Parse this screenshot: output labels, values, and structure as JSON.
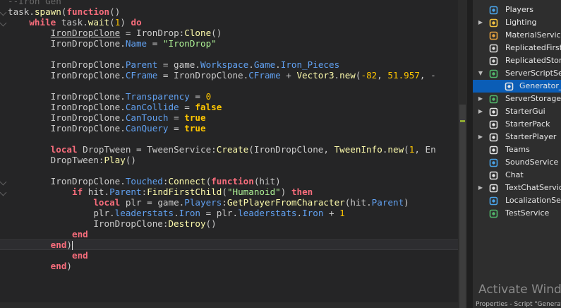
{
  "editor": {
    "lines": [
      [
        {
          "t": "--Iron Gen",
          "c": "faded"
        }
      ],
      [
        {
          "t": "task",
          "c": "plain"
        },
        {
          "t": ".",
          "c": "op"
        },
        {
          "t": "spawn",
          "c": "fn"
        },
        {
          "t": "(",
          "c": "op"
        },
        {
          "t": "function",
          "c": "kw"
        },
        {
          "t": "()",
          "c": "op"
        }
      ],
      [
        {
          "t": "    ",
          "c": "plain"
        },
        {
          "t": "while",
          "c": "kw"
        },
        {
          "t": " task",
          "c": "plain"
        },
        {
          "t": ".",
          "c": "op"
        },
        {
          "t": "wait",
          "c": "fn"
        },
        {
          "t": "(",
          "c": "op"
        },
        {
          "t": "1",
          "c": "num"
        },
        {
          "t": ") ",
          "c": "op"
        },
        {
          "t": "do",
          "c": "kw"
        }
      ],
      [
        {
          "t": "        ",
          "c": "plain"
        },
        {
          "t": "IronDropClone",
          "c": "plain ul"
        },
        {
          "t": " = IronDrop:",
          "c": "plain"
        },
        {
          "t": "Clone",
          "c": "fn"
        },
        {
          "t": "()",
          "c": "op"
        }
      ],
      [
        {
          "t": "        IronDropClone.",
          "c": "plain"
        },
        {
          "t": "Name",
          "c": "prop"
        },
        {
          "t": " = ",
          "c": "op"
        },
        {
          "t": "\"IronDrop\"",
          "c": "str"
        }
      ],
      [
        {
          "t": "",
          "c": "plain"
        }
      ],
      [
        {
          "t": "        IronDropClone.",
          "c": "plain"
        },
        {
          "t": "Parent",
          "c": "prop"
        },
        {
          "t": " = game.",
          "c": "plain"
        },
        {
          "t": "Workspace",
          "c": "prop"
        },
        {
          "t": ".",
          "c": "op"
        },
        {
          "t": "Game",
          "c": "prop"
        },
        {
          "t": ".",
          "c": "op"
        },
        {
          "t": "Iron_Pieces",
          "c": "prop"
        }
      ],
      [
        {
          "t": "        IronDropClone.",
          "c": "plain"
        },
        {
          "t": "CFrame",
          "c": "prop"
        },
        {
          "t": " = IronDropClone.",
          "c": "plain"
        },
        {
          "t": "CFrame",
          "c": "prop"
        },
        {
          "t": " + ",
          "c": "op"
        },
        {
          "t": "Vector3",
          "c": "fn"
        },
        {
          "t": ".",
          "c": "op"
        },
        {
          "t": "new",
          "c": "fn"
        },
        {
          "t": "(",
          "c": "op"
        },
        {
          "t": "-82",
          "c": "num"
        },
        {
          "t": ", ",
          "c": "op"
        },
        {
          "t": "51.957",
          "c": "num"
        },
        {
          "t": ", -",
          "c": "op"
        }
      ],
      [
        {
          "t": "",
          "c": "plain"
        }
      ],
      [
        {
          "t": "        IronDropClone.",
          "c": "plain"
        },
        {
          "t": "Transparency",
          "c": "prop"
        },
        {
          "t": " = ",
          "c": "op"
        },
        {
          "t": "0",
          "c": "num"
        }
      ],
      [
        {
          "t": "        IronDropClone.",
          "c": "plain"
        },
        {
          "t": "CanCollide",
          "c": "prop"
        },
        {
          "t": " = ",
          "c": "op"
        },
        {
          "t": "false",
          "c": "bool"
        }
      ],
      [
        {
          "t": "        IronDropClone.",
          "c": "plain"
        },
        {
          "t": "CanTouch",
          "c": "prop"
        },
        {
          "t": " = ",
          "c": "op"
        },
        {
          "t": "true",
          "c": "bool"
        }
      ],
      [
        {
          "t": "        IronDropClone.",
          "c": "plain"
        },
        {
          "t": "CanQuery",
          "c": "prop"
        },
        {
          "t": " = ",
          "c": "op"
        },
        {
          "t": "true",
          "c": "bool"
        }
      ],
      [
        {
          "t": "",
          "c": "plain"
        }
      ],
      [
        {
          "t": "        ",
          "c": "plain"
        },
        {
          "t": "local",
          "c": "kw"
        },
        {
          "t": " DropTween = TweenService:",
          "c": "plain"
        },
        {
          "t": "Create",
          "c": "fn"
        },
        {
          "t": "(IronDropClone, ",
          "c": "plain"
        },
        {
          "t": "TweenInfo",
          "c": "fn"
        },
        {
          "t": ".",
          "c": "op"
        },
        {
          "t": "new",
          "c": "fn"
        },
        {
          "t": "(",
          "c": "op"
        },
        {
          "t": "1",
          "c": "num"
        },
        {
          "t": ", En",
          "c": "plain"
        }
      ],
      [
        {
          "t": "        DropTween:",
          "c": "plain"
        },
        {
          "t": "Play",
          "c": "fn"
        },
        {
          "t": "()",
          "c": "op"
        }
      ],
      [
        {
          "t": "",
          "c": "plain"
        }
      ],
      [
        {
          "t": "        IronDropClone.",
          "c": "plain"
        },
        {
          "t": "Touched",
          "c": "prop"
        },
        {
          "t": ":",
          "c": "op"
        },
        {
          "t": "Connect",
          "c": "fn"
        },
        {
          "t": "(",
          "c": "op"
        },
        {
          "t": "function",
          "c": "kw"
        },
        {
          "t": "(hit)",
          "c": "plain"
        }
      ],
      [
        {
          "t": "            ",
          "c": "plain"
        },
        {
          "t": "if",
          "c": "kw"
        },
        {
          "t": " hit.",
          "c": "plain"
        },
        {
          "t": "Parent",
          "c": "prop"
        },
        {
          "t": ":",
          "c": "op"
        },
        {
          "t": "FindFirstChild",
          "c": "fn"
        },
        {
          "t": "(",
          "c": "op"
        },
        {
          "t": "\"Humanoid\"",
          "c": "str"
        },
        {
          "t": ") ",
          "c": "op"
        },
        {
          "t": "then",
          "c": "kw"
        }
      ],
      [
        {
          "t": "                ",
          "c": "plain"
        },
        {
          "t": "local",
          "c": "kw"
        },
        {
          "t": " plr = game.",
          "c": "plain"
        },
        {
          "t": "Players",
          "c": "prop"
        },
        {
          "t": ":",
          "c": "op"
        },
        {
          "t": "GetPlayerFromCharacter",
          "c": "fn"
        },
        {
          "t": "(hit.",
          "c": "plain"
        },
        {
          "t": "Parent",
          "c": "prop"
        },
        {
          "t": ")",
          "c": "op"
        }
      ],
      [
        {
          "t": "                plr.",
          "c": "plain"
        },
        {
          "t": "leaderstats",
          "c": "prop"
        },
        {
          "t": ".",
          "c": "op"
        },
        {
          "t": "Iron",
          "c": "prop"
        },
        {
          "t": " = plr.",
          "c": "plain"
        },
        {
          "t": "leaderstats",
          "c": "prop"
        },
        {
          "t": ".",
          "c": "op"
        },
        {
          "t": "Iron",
          "c": "prop"
        },
        {
          "t": " + ",
          "c": "op"
        },
        {
          "t": "1",
          "c": "num"
        }
      ],
      [
        {
          "t": "                IronDropClone:",
          "c": "plain"
        },
        {
          "t": "Destroy",
          "c": "fn"
        },
        {
          "t": "()",
          "c": "op"
        }
      ],
      [
        {
          "t": "            ",
          "c": "plain"
        },
        {
          "t": "end",
          "c": "kw"
        }
      ],
      [
        {
          "t": "        ",
          "c": "plain"
        },
        {
          "t": "end",
          "c": "kw"
        },
        {
          "t": ")",
          "c": "op"
        }
      ],
      [
        {
          "t": "            ",
          "c": "plain"
        },
        {
          "t": "end",
          "c": "kw"
        }
      ],
      [
        {
          "t": "        ",
          "c": "plain"
        },
        {
          "t": "end",
          "c": "kw"
        },
        {
          "t": ")",
          "c": "op"
        }
      ]
    ],
    "current_line_index": 23,
    "fold_line_indices": [
      1,
      2,
      17,
      18
    ]
  },
  "explorer": {
    "items": [
      {
        "label": "Players",
        "icon": "players-icon",
        "arrow": "",
        "color": "#4aa3e8"
      },
      {
        "label": "Lighting",
        "icon": "lighting-icon",
        "arrow": "▶",
        "color": "#f5c542"
      },
      {
        "label": "MaterialService",
        "icon": "material-service-icon",
        "arrow": "",
        "color": "#e8a341"
      },
      {
        "label": "ReplicatedFirst",
        "icon": "replicated-first-icon",
        "arrow": "",
        "color": "#d9d9d9"
      },
      {
        "label": "ReplicatedStorage",
        "icon": "replicated-storage-icon",
        "arrow": "",
        "color": "#d9d9d9"
      },
      {
        "label": "ServerScriptService",
        "icon": "server-script-service-icon",
        "arrow": "▼",
        "color": "#52b86b"
      },
      {
        "label": "Generator_Iron",
        "icon": "script-icon",
        "arrow": "",
        "color": "#e6e6e6",
        "child": true,
        "selected": true
      },
      {
        "label": "ServerStorage",
        "icon": "server-storage-icon",
        "arrow": "▶",
        "color": "#52b86b"
      },
      {
        "label": "StarterGui",
        "icon": "starter-gui-icon",
        "arrow": "▶",
        "color": "#e6e6e6"
      },
      {
        "label": "StarterPack",
        "icon": "starter-pack-icon",
        "arrow": "",
        "color": "#e6e6e6"
      },
      {
        "label": "StarterPlayer",
        "icon": "starter-player-icon",
        "arrow": "▶",
        "color": "#e6e6e6"
      },
      {
        "label": "Teams",
        "icon": "teams-icon",
        "arrow": "",
        "color": "#e6e6e6"
      },
      {
        "label": "SoundService",
        "icon": "sound-service-icon",
        "arrow": "",
        "color": "#4aa3e8"
      },
      {
        "label": "Chat",
        "icon": "chat-icon",
        "arrow": "",
        "color": "#e6e6e6"
      },
      {
        "label": "TextChatService",
        "icon": "text-chat-service-icon",
        "arrow": "▶",
        "color": "#e6e6e6"
      },
      {
        "label": "LocalizationService",
        "icon": "localization-service-icon",
        "arrow": "",
        "color": "#4aa3e8"
      },
      {
        "label": "TestService",
        "icon": "test-service-icon",
        "arrow": "",
        "color": "#52b86b"
      }
    ]
  },
  "watermark": "Activate Windows",
  "bottom_tabs": "Properties - Script \"Generator_Iron\""
}
